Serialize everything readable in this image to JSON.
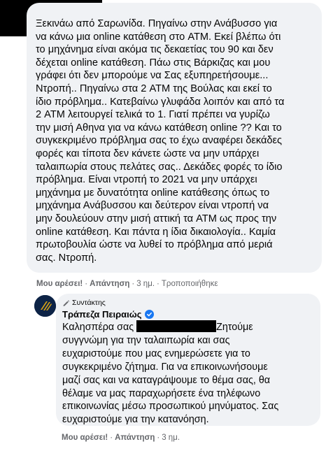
{
  "comment": {
    "text": "Ξεκινάω από Σαρωνίδα. Πηγαίνω στην Ανάβυσσο για\nνα κάνω μια online κατάθεση στο ATM. Εκεί βλέπω ότι\nτο μηχάνημα είναι ακόμα τις δεκαετίας του 90 και δεν\nδέχεται online κατάθεση. Πάω στις Βάρκιζας και μου\nγράφει ότι δεν μπορούμε να Σας εξυπηρετήσουμε...\nΝτροπή.. Πηγαίνω στα 2 ATM της Βούλας και εκεί το\nίδιο πρόβλημα.. Κατεβαίνω γλυφάδα λοιπόν και από τα\n2 ATM λειτουργεί τελικά το 1. Γιατί πρέπει να γυρίζω\nτην μισή Αθηνα για να κάνω κατάθεση online ?? Και το\nσυγκεκριμένο πρόβλημα σας το έχω αναφέρει δεκάδες\nφορές και τίποτα δεν κάνετε ώστε να μην υπάρχει\nταλαιπωρία στους πελάτες σας.. Δεκάδες φορές το ίδιο\nπρόβλημα. Είναι ντροπή το 2021 να μην υπάρχει\nμηχάνημα με δυνατότητα online κατάθεσης όπως το\nμηχάνημα Ανάβυσσου και δεύτερον είναι ντροπή να\nμην δουλεύουν στην μισή αττική τα ATM ως προς την\nonline κατάθεση. Και πάντα η ίδια δικαιολογία.. Καμία\nπρωτοβουλία ώστε να λυθεί το πρόβλημα από μεριά\nσας. Ντροπή.",
    "like_label": "Μου αρέσει!",
    "reply_label": "Απάντηση",
    "separator": "·",
    "time": "3 ημ.",
    "edited_label": "Τροποποιήθηκε"
  },
  "reply": {
    "badge_label": "Συντάκτης",
    "author": "Τράπεζα Πειραιώς",
    "text_before": "Καλησπέρα σας",
    "text_after": "Ζητούμε\nσυγγνώμη για την ταλαιπωρία και σας\nευχαριστούμε που μας ενημερώσετε για το\nσυγκεκριμένο ζήτημα. Για να επικοινωνήσουμε\nμαζί σας και να καταγράψουμε το θέμα σας, θα\nθέλαμε να μας παραχωρήσετε ένα τηλέφωνο\nεπικοινωνίας μέσω προσωπικού μηνύματος. Σας\nευχαριστούμε για την κατανόηση.",
    "like_label": "Μου αρέσει!",
    "reply_label": "Απάντηση",
    "separator": "·",
    "time": "3 ημ."
  },
  "colors": {
    "bubble": "#f0f2f5",
    "meta": "#65676b",
    "verified": "#1877f2",
    "avatar_bg": "#0d2346",
    "logo_gold": "#d4a017"
  }
}
